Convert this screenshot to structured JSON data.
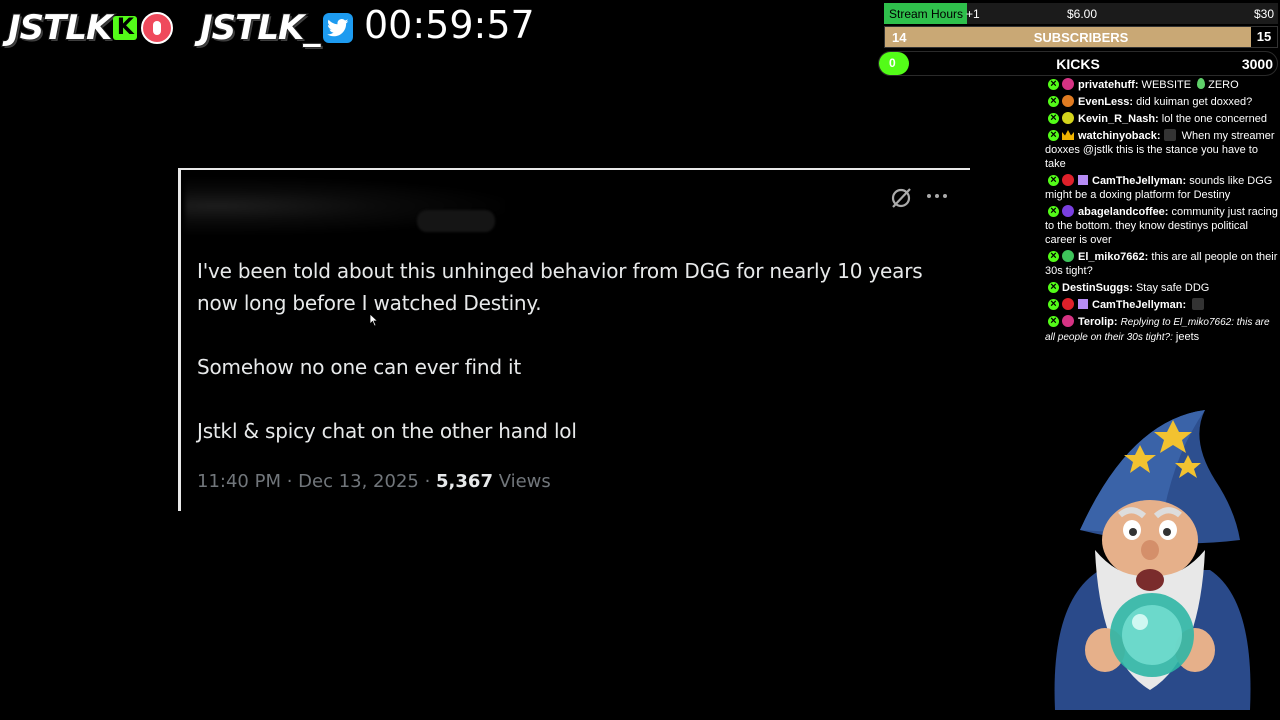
{
  "branding": {
    "kick_name": "JSTLK",
    "kick_badge": "K",
    "twitter_name": "JSTLK_",
    "icons": [
      "kick-icon",
      "record-icon",
      "twitter-bird-icon"
    ]
  },
  "timer": "00:59:57",
  "stream_hours": {
    "label": "Stream Hours",
    "increment": "+1",
    "mid_value": "$6.00",
    "goal_value": "$30",
    "fill_fraction": 0.21,
    "color": "#2fc04c"
  },
  "subscribers": {
    "current": "14",
    "label": "SUBSCRIBERS",
    "goal": "15",
    "fill_fraction": 0.93,
    "color": "#c9a875"
  },
  "kicks": {
    "current": "0",
    "label": "KICKS",
    "goal": "3000",
    "color": "#53fc18"
  },
  "tweet": {
    "lines": [
      "I've been told about this unhinged behavior from DGG for nearly 10 years",
      "now long before I watched Destiny.",
      "Somehow no one can ever find it",
      "Jstkl & spicy chat on the other hand lol"
    ],
    "time": "11:40 PM · Dec 13, 2025 · ",
    "views_count": "5,367",
    "views_label": " Views",
    "icons": [
      "grok-icon",
      "more-options-icon"
    ]
  },
  "chat": [
    {
      "user": "privatehuff:",
      "text": " WEBSITE ",
      "extra": "ZERO",
      "dot": "#d63384",
      "badge": "dot"
    },
    {
      "user": "EvenLess:",
      "text": " did kuiman get doxxed?",
      "dot": "#e07b21",
      "badge": "dot"
    },
    {
      "user": "Kevin_R_Nash:",
      "text": " lol the one concerned",
      "dot": "#d4d41c",
      "badge": "dot"
    },
    {
      "user": "watchinyoback:",
      "text": " When my streamer doxxes @jstlk this is the stance you have to take",
      "badge": "crown"
    },
    {
      "user": "CamTheJellyman:",
      "text": " sounds like DGG might be a doxing platform for Destiny",
      "dot": "#e0202a",
      "badge": "gift"
    },
    {
      "user": "abagelandcoffee:",
      "text": " community just racing to the bottom. they know destinys political career is over",
      "dot": "#7a3fe0",
      "badge": "dot"
    },
    {
      "user": "El_miko7662:",
      "text": " this are all people on their 30s tight?",
      "dot": "#3ec45b",
      "badge": "dot"
    },
    {
      "user": "DestinSuggs:",
      "text": " Stay safe DDG",
      "badge": "none"
    },
    {
      "user": "CamTheJellyman:",
      "text": "",
      "dot": "#e0202a",
      "badge": "gift"
    },
    {
      "user": "Terolip:",
      "reply": "Replying to El_miko7662: this are all people on their 30s tight?:",
      "text": " jeets",
      "dot": "#d63384",
      "badge": "dot"
    }
  ]
}
